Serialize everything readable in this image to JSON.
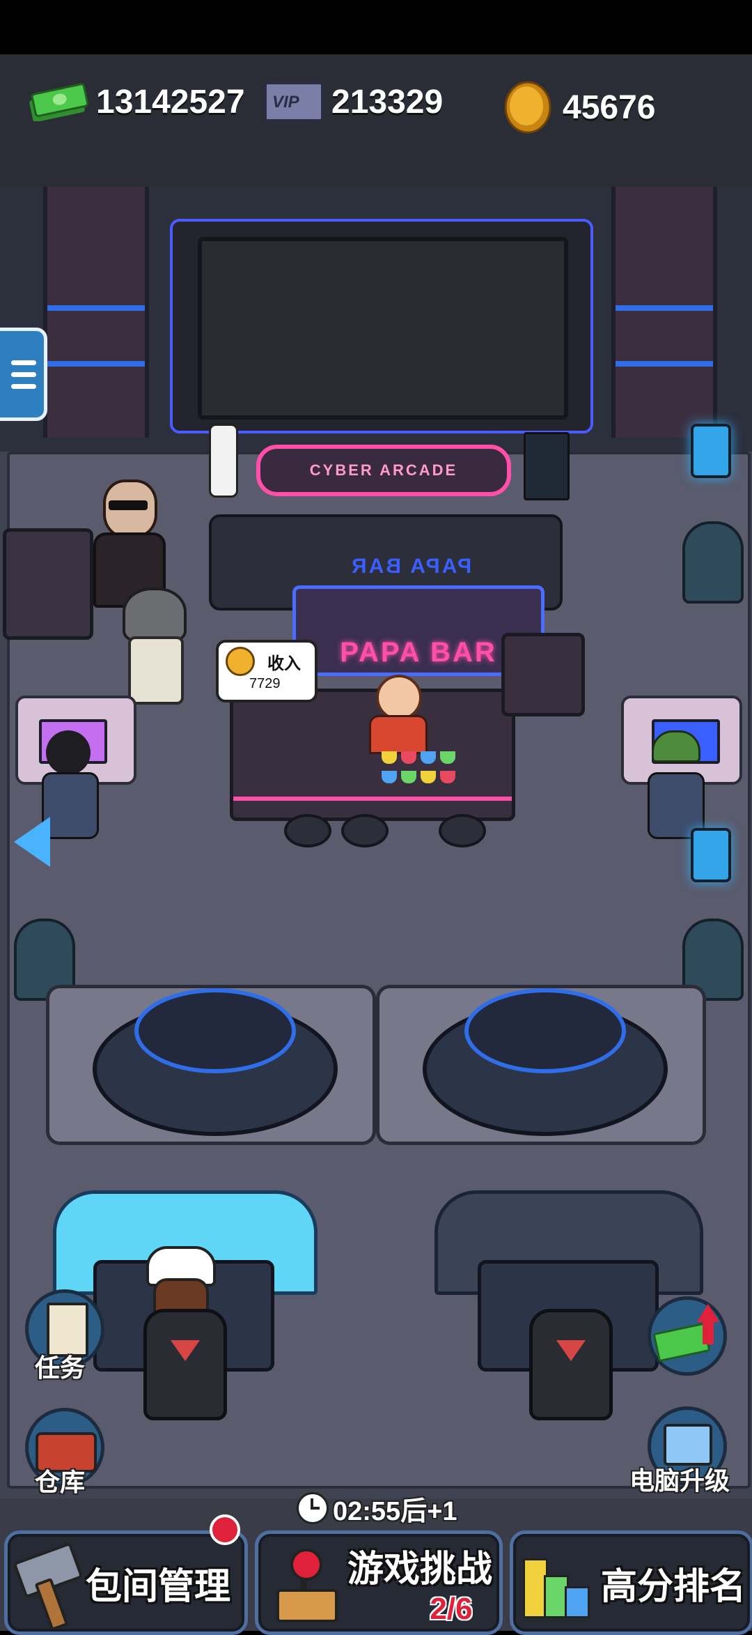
{
  "resources": {
    "cash": "13142527",
    "vip": "213329",
    "coins": "45676",
    "vip_badge": "VIP"
  },
  "scene": {
    "arcade_sign": "CYBER ARCADE",
    "bar_sign": "PAPA BAR",
    "bar_sign_reflection": "PAPA BAR",
    "income_label": "收入",
    "income_value": "7729"
  },
  "side_buttons": {
    "tasks": "任务",
    "warehouse": "仓库",
    "pc_upgrade": "电脑升级"
  },
  "timer": {
    "text": "02:55后+1"
  },
  "bottom_nav": {
    "room_management": "包间管理",
    "game_challenge": "游戏挑战",
    "challenge_progress": "2/6",
    "leaderboard": "高分排名"
  },
  "colors": {
    "neon_pink": "#ff4fa8",
    "neon_blue": "#4a6cff",
    "progress_red": "#e0213a",
    "cash_green": "#4cc94a",
    "coin_gold": "#e8a925"
  }
}
